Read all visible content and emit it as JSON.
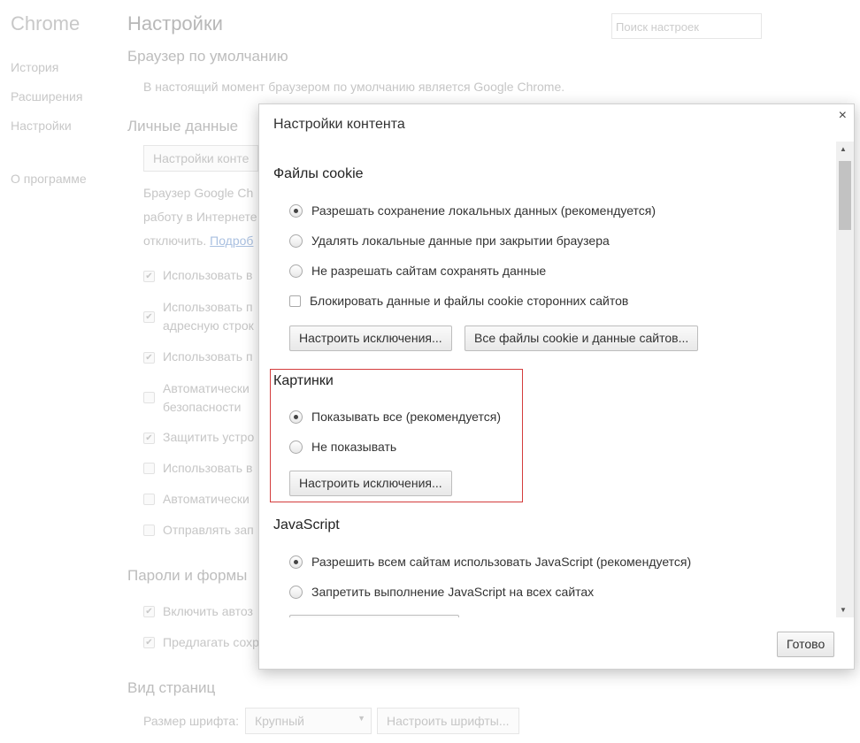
{
  "sidebar": {
    "brand": "Chrome",
    "items": [
      "История",
      "Расширения",
      "Настройки",
      "О программе"
    ]
  },
  "page": {
    "title": "Настройки",
    "search_placeholder": "Поиск настроек",
    "default_browser": {
      "heading": "Браузер по умолчанию",
      "text": "В настоящий момент браузером по умолчанию является Google Chrome."
    },
    "privacy": {
      "heading": "Личные данные",
      "content_button": "Настройки конте",
      "text1": "Браузер Google Ch",
      "text2": "работу в Интернете",
      "text3": "отключить.",
      "link": "Подроб",
      "checkboxes": [
        {
          "label": "Использовать в",
          "checked": true
        },
        {
          "label": "Использовать п",
          "label2": "адресную строк",
          "checked": true
        },
        {
          "label": "Использовать п",
          "checked": true
        },
        {
          "label": "Автоматически",
          "label2": "безопасности",
          "checked": false
        },
        {
          "label": "Защитить устро",
          "checked": true
        },
        {
          "label": "Использовать в",
          "checked": false
        },
        {
          "label": "Автоматически",
          "checked": false
        },
        {
          "label": "Отправлять зап",
          "checked": false
        }
      ]
    },
    "passwords": {
      "heading": "Пароли и формы",
      "checkboxes": [
        {
          "label": "Включить автоз",
          "checked": true
        },
        {
          "label": "Предлагать сохр",
          "checked": true
        }
      ]
    },
    "appearance": {
      "heading": "Вид страниц",
      "font_size_label": "Размер шрифта:",
      "font_size_value": "Крупный",
      "fonts_button": "Настроить шрифты..."
    }
  },
  "dialog": {
    "title": "Настройки контента",
    "close": "×",
    "done": "Готово",
    "cookies": {
      "heading": "Файлы cookie",
      "options": [
        "Разрешать сохранение локальных данных (рекомендуется)",
        "Удалять локальные данные при закрытии браузера",
        "Не разрешать сайтам сохранять данные"
      ],
      "selected": 0,
      "block_third_party": "Блокировать данные и файлы cookie сторонних сайтов",
      "exceptions": "Настроить исключения...",
      "all_cookies": "Все файлы cookie и данные сайтов..."
    },
    "images": {
      "heading": "Картинки",
      "options": [
        "Показывать все (рекомендуется)",
        "Не показывать"
      ],
      "selected": 0,
      "exceptions": "Настроить исключения..."
    },
    "javascript": {
      "heading": "JavaScript",
      "options": [
        "Разрешить всем сайтам использовать JavaScript (рекомендуется)",
        "Запретить выполнение JavaScript на всех сайтах"
      ],
      "selected": 0
    }
  },
  "colors": {
    "highlight": "#d43c3c"
  }
}
